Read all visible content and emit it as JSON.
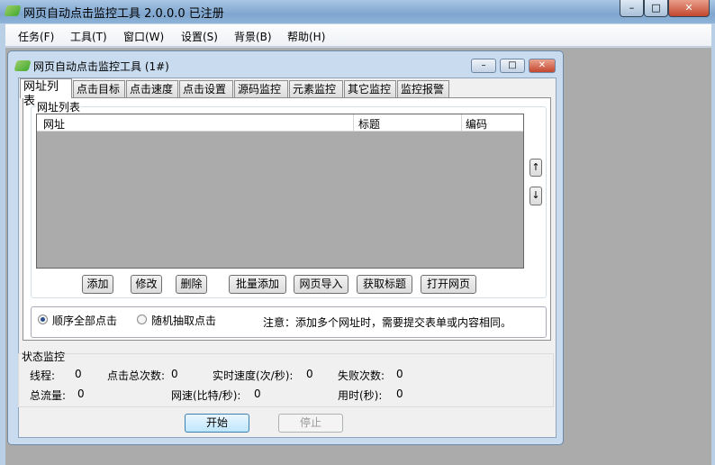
{
  "app": {
    "title": "网页自动点击监控工具 2.0.0.0  已注册",
    "controls": [
      "–",
      "□",
      "✕"
    ]
  },
  "menu": [
    "任务(F)",
    "工具(T)",
    "窗口(W)",
    "设置(S)",
    "背景(B)",
    "帮助(H)"
  ],
  "child": {
    "title": "网页自动点击监控工具  (1#)",
    "controls": [
      "–",
      "□",
      "✕"
    ]
  },
  "tabs": [
    "网址列表",
    "点击目标",
    "点击速度",
    "点击设置",
    "源码监控",
    "元素监控",
    "其它监控",
    "监控报警"
  ],
  "url_group": {
    "label": "网址列表",
    "columns": [
      "网址",
      "标题",
      "编码"
    ],
    "rows": [],
    "up": "↑",
    "down": "↓",
    "buttons": [
      "添加",
      "修改",
      "删除",
      "批量添加",
      "网页导入",
      "获取标题",
      "打开网页"
    ]
  },
  "mode": {
    "options": [
      "顺序全部点击",
      "随机抽取点击"
    ],
    "selected": 0,
    "note": "注意：添加多个网址时，需要提交表单或内容相同。"
  },
  "status": {
    "label": "状态监控",
    "threads": {
      "label": "线程:",
      "value": "0"
    },
    "total_clicks": {
      "label": "点击总次数:",
      "value": "0"
    },
    "speed": {
      "label": "实时速度(次/秒):",
      "value": "0"
    },
    "failures": {
      "label": "失败次数:",
      "value": "0"
    },
    "traffic": {
      "label": "总流量:",
      "value": "0"
    },
    "net_speed": {
      "label": "网速(比特/秒):",
      "value": "0"
    },
    "elapsed": {
      "label": "用时(秒):",
      "value": "0"
    }
  },
  "actions": {
    "start": "开始",
    "stop": "停止"
  }
}
